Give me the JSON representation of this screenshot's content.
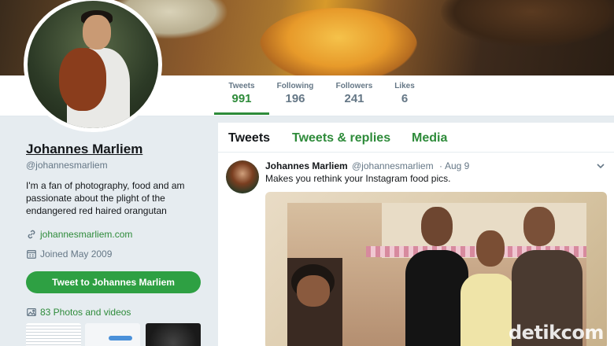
{
  "profile": {
    "name": "Johannes Marliem",
    "handle": "@johannesmarliem",
    "bio": "I'm a fan of photography, food and am passionate about the plight of the endangered red haired orangutan",
    "website": "johannesmarliem.com",
    "joined": "Joined May 2009",
    "tweet_button": "Tweet to Johannes Marliem",
    "photos_link": "83 Photos and videos"
  },
  "stats": [
    {
      "label": "Tweets",
      "value": "991"
    },
    {
      "label": "Following",
      "value": "196"
    },
    {
      "label": "Followers",
      "value": "241"
    },
    {
      "label": "Likes",
      "value": "6"
    }
  ],
  "tabs": [
    {
      "label": "Tweets"
    },
    {
      "label": "Tweets & replies"
    },
    {
      "label": "Media"
    }
  ],
  "tweet": {
    "name": "Johannes Marliem",
    "handle": "@johannesmarliem",
    "separator": "·",
    "date": "Aug 9",
    "text": "Makes you rethink your Instagram food pics."
  },
  "watermark": "detikcom",
  "colors": {
    "accent": "#2e8b3a",
    "button": "#2ea043",
    "page_bg": "#e6ecf0",
    "muted_text": "#657786"
  },
  "icons": {
    "link": "link-icon",
    "calendar": "calendar-icon",
    "photos": "photo-icon",
    "chevron": "chevron-down-icon"
  }
}
